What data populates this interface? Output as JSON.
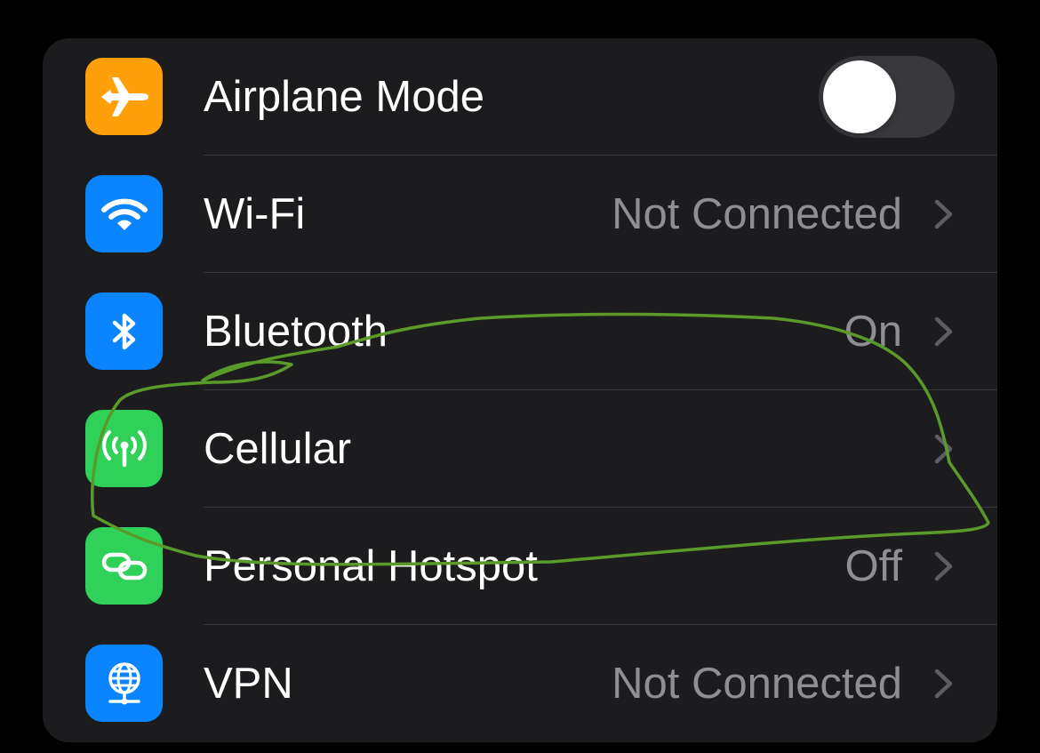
{
  "colors": {
    "background": "#000000",
    "group_background": "#1c1c1e",
    "label": "#ffffff",
    "secondary_value": "#8e8e93",
    "divider": "#38383a",
    "annotation_stroke": "#5a9a2a"
  },
  "settings": {
    "rows": [
      {
        "label": "Airplane Mode",
        "icon": "airplane-icon",
        "icon_color": "#ff9f0a",
        "control": "toggle",
        "toggle_on": false
      },
      {
        "label": "Wi-Fi",
        "icon": "wifi-icon",
        "icon_color": "#0a84ff",
        "value": "Not Connected"
      },
      {
        "label": "Bluetooth",
        "icon": "bluetooth-icon",
        "icon_color": "#0a84ff",
        "value": "On"
      },
      {
        "label": "Cellular",
        "icon": "cellular-antenna-icon",
        "icon_color": "#30d158",
        "value": ""
      },
      {
        "label": "Personal Hotspot",
        "icon": "personal-hotspot-icon",
        "icon_color": "#30d158",
        "value": "Off"
      },
      {
        "label": "VPN",
        "icon": "vpn-globe-icon",
        "icon_color": "#0a84ff",
        "value": "Not Connected"
      }
    ]
  }
}
